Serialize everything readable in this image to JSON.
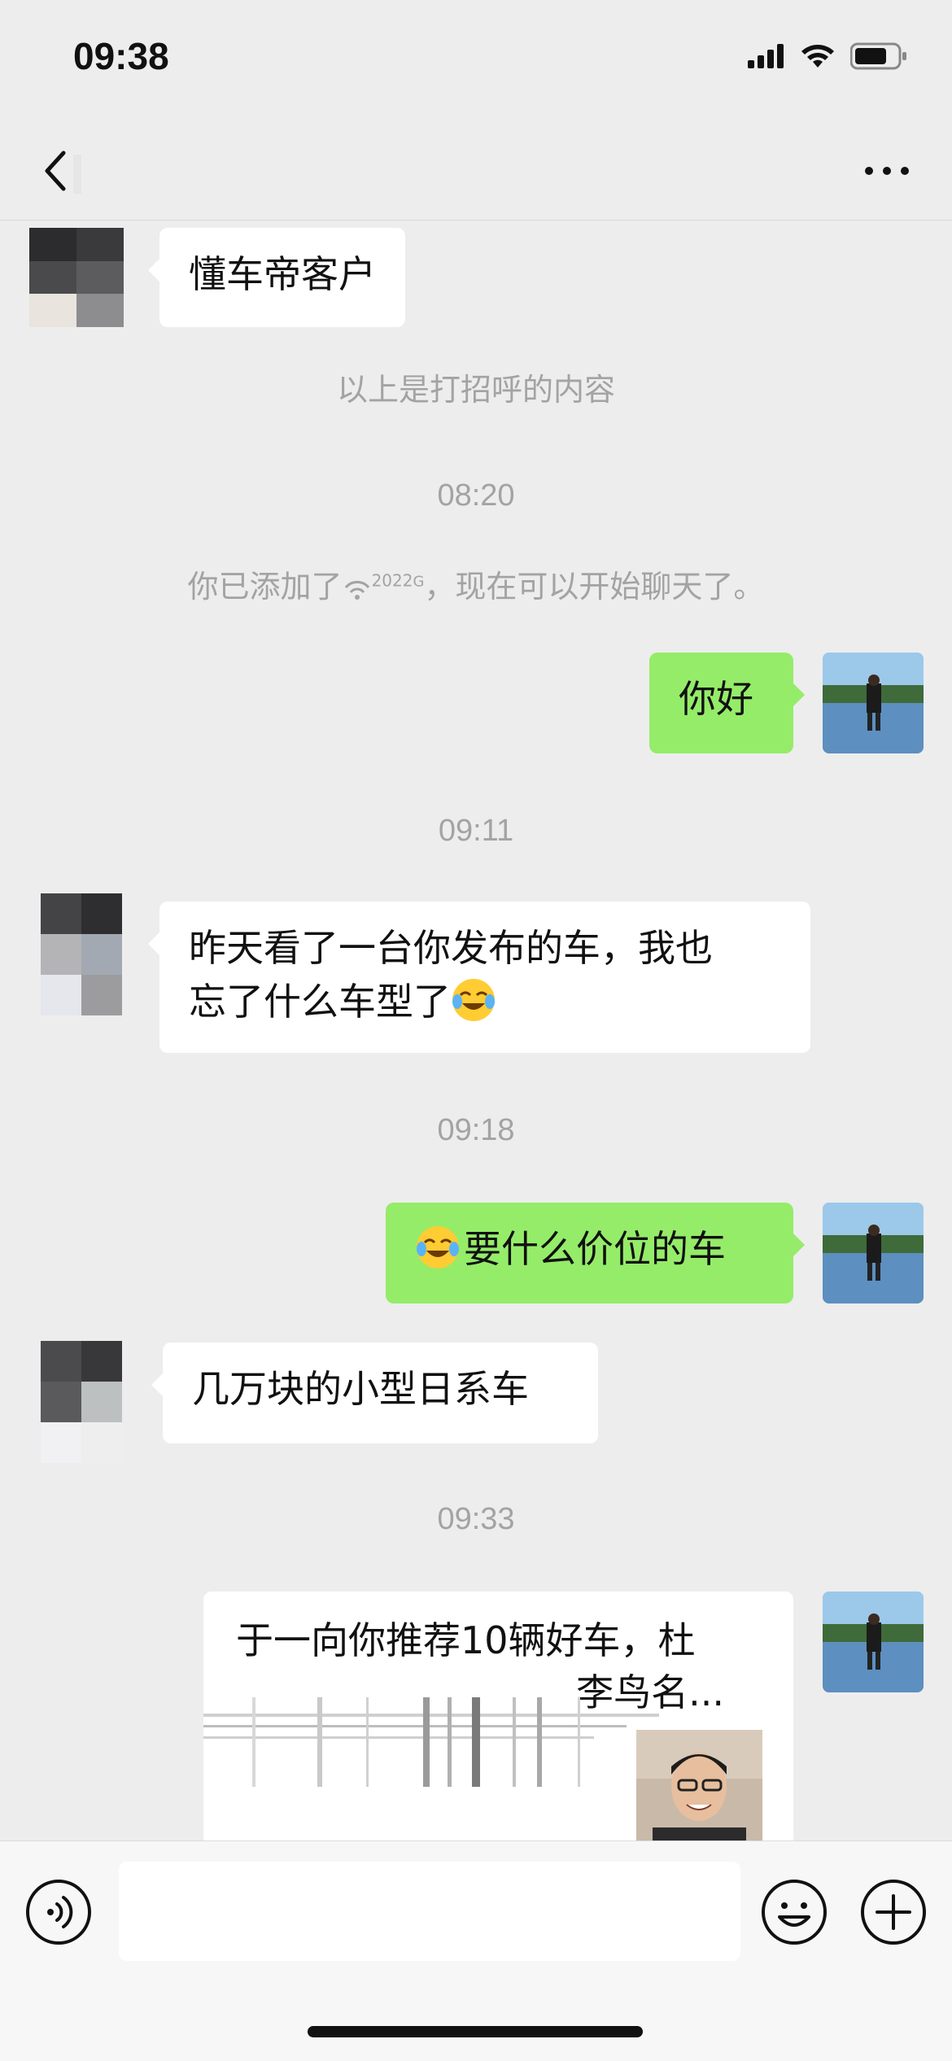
{
  "status_bar": {
    "time": "09:38"
  },
  "nav": {
    "title": "",
    "back_icon": "chevron-left-icon",
    "more_icon": "ellipsis-icon"
  },
  "messages": [
    {
      "side": "in",
      "text": "懂车帝客户"
    },
    {
      "type": "system",
      "text": "以上是打招呼的内容"
    },
    {
      "type": "time",
      "text": "08:20"
    },
    {
      "type": "system",
      "prefix": "你已添加了",
      "nickname": "2022",
      "nickname_suffix": "G",
      "suffix": "，现在可以开始聊天了。"
    },
    {
      "side": "out",
      "text": "你好"
    },
    {
      "type": "time",
      "text": "09:11"
    },
    {
      "side": "in",
      "line1": "昨天看了一台你发布的车，我也",
      "line2": "忘了什么车型了"
    },
    {
      "type": "time",
      "text": "09:18"
    },
    {
      "side": "out",
      "text": "要什么价位的车"
    },
    {
      "side": "in",
      "text": "几万块的小型日系车"
    },
    {
      "type": "time",
      "text": "09:33"
    },
    {
      "side": "out",
      "type": "link-card",
      "title_line1": "于一向你推荐10辆好车，杜",
      "title_line2": "李鸟名..."
    }
  ],
  "colors": {
    "background": "#ededed",
    "outgoing_bubble": "#95ec69",
    "incoming_bubble": "#ffffff",
    "system_text": "#a3a3a3"
  },
  "input_bar": {
    "voice_icon": "voice-icon",
    "emoji_icon": "smiley-icon",
    "plus_icon": "plus-circle-icon",
    "value": ""
  }
}
